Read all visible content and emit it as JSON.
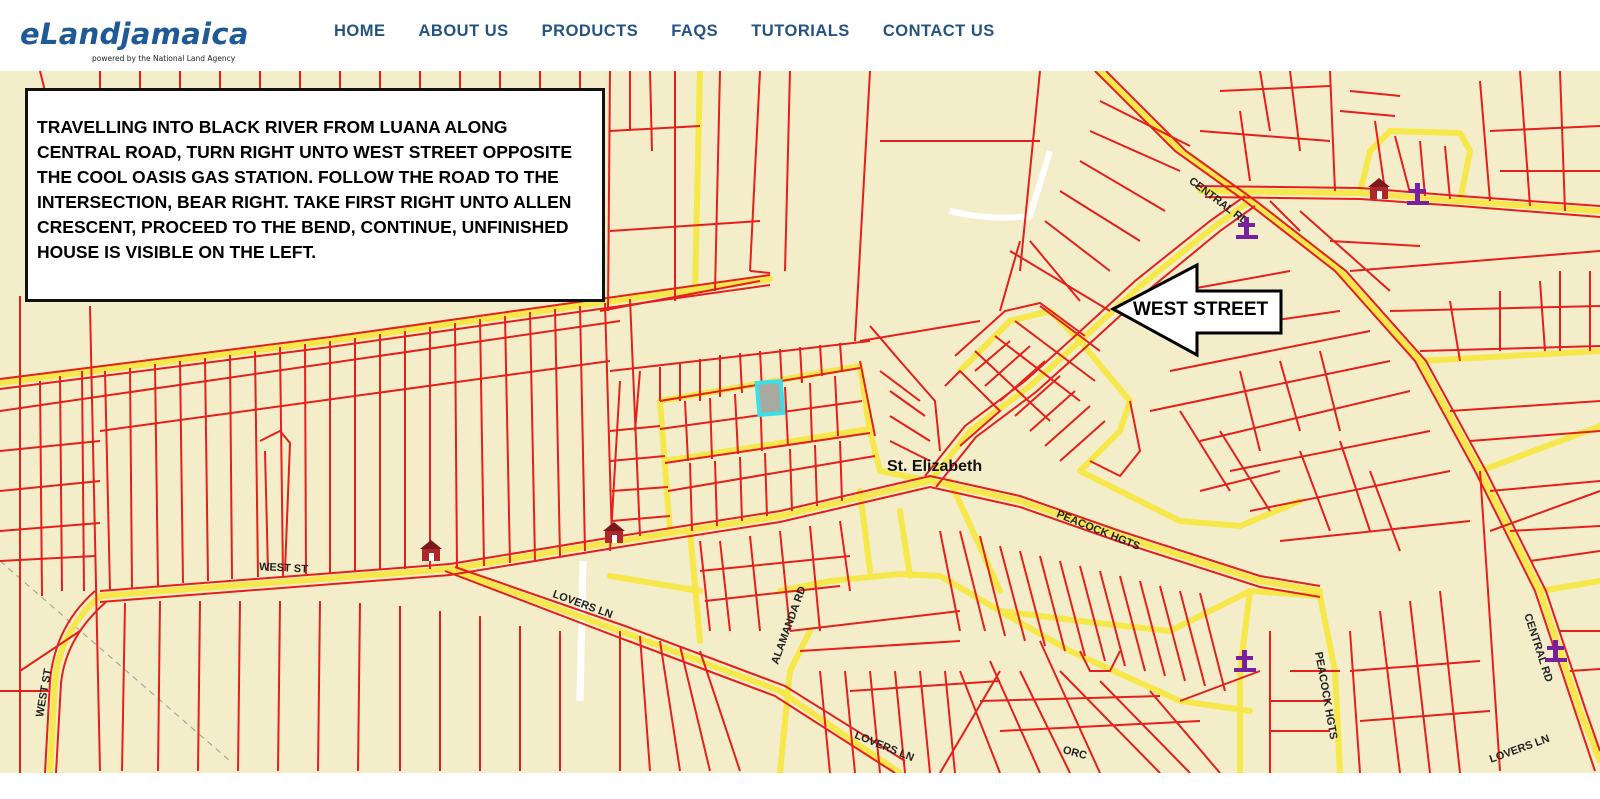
{
  "brand": {
    "name": "eLandjamaica",
    "tagline": "powered by the National Land Agency"
  },
  "nav": {
    "items": [
      "HOME",
      "ABOUT US",
      "PRODUCTS",
      "FAQS",
      "TUTORIALS",
      "CONTACT US"
    ]
  },
  "map": {
    "directions": "TRAVELLING INTO BLACK RIVER FROM LUANA ALONG CENTRAL ROAD, TURN RIGHT UNTO WEST STREET OPPOSITE THE COOL OASIS GAS STATION. FOLLOW THE ROAD TO THE INTERSECTION, BEAR RIGHT. TAKE FIRST RIGHT UNTO ALLEN CRESCENT, PROCEED TO THE BEND, CONTINUE, UNFINISHED HOUSE IS VISIBLE ON THE LEFT.",
    "arrow_label": "WEST STREET",
    "place_label": "St. Elizabeth",
    "road_labels": {
      "central_rd_top": "CENTRAL RD",
      "central_rd_right": "CENTRAL RD",
      "west_st": "WEST ST",
      "west_st_vertical": "WEST ST",
      "lovers_ln": "LOVERS LN",
      "lovers_ln_bottom": "LOVERS LN",
      "lovers_ln_right": "LOVERS LN",
      "alamanda_rd": "ALAMANDA RD",
      "peacock_hgts": "PEACOCK HGTS",
      "peacock_hgts_vertical": "PEACOCK HGTS",
      "orchid": "ORC"
    },
    "icons": [
      "school-icon",
      "church-icon"
    ],
    "colors": {
      "background": "#f4edca",
      "parcel_line": "#e3201b",
      "road_fill": "#f6e74a",
      "highlight": "#38e0ec",
      "church": "#7a1fa0",
      "school": "#b0262a"
    }
  }
}
